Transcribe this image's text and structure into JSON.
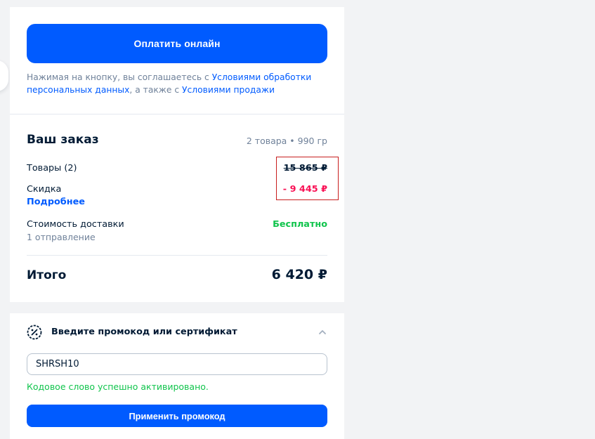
{
  "payment": {
    "pay_button_label": "Оплатить онлайн",
    "agreement": {
      "prefix": "Нажимая на кнопку, вы соглашаетесь с ",
      "link1": "Условиями обработки персональных данных",
      "middle": ", а также с ",
      "link2": "Условиями продажи"
    }
  },
  "order": {
    "title": "Ваш заказ",
    "meta": "2 товара • 990 гр",
    "goods_label": "Товары (2)",
    "goods_value": "15 865 ₽",
    "discount_label": "Скидка",
    "discount_value": "- 9 445 ₽",
    "details_link": "Подробнее",
    "delivery_label": "Стоимость доставки",
    "delivery_sub": "1 отправление",
    "delivery_value": "Бесплатно",
    "total_label": "Итого",
    "total_value": "6 420 ₽"
  },
  "promo": {
    "title": "Введите промокод или сертификат",
    "input_value": "SHRSH10",
    "success_message": "Кодовое слово успешно активировано.",
    "apply_button_label": "Применить промокод"
  },
  "colors": {
    "accent": "#005bff",
    "discount": "#f91155",
    "success": "#10c44c",
    "highlight_border": "#c81e1e"
  }
}
